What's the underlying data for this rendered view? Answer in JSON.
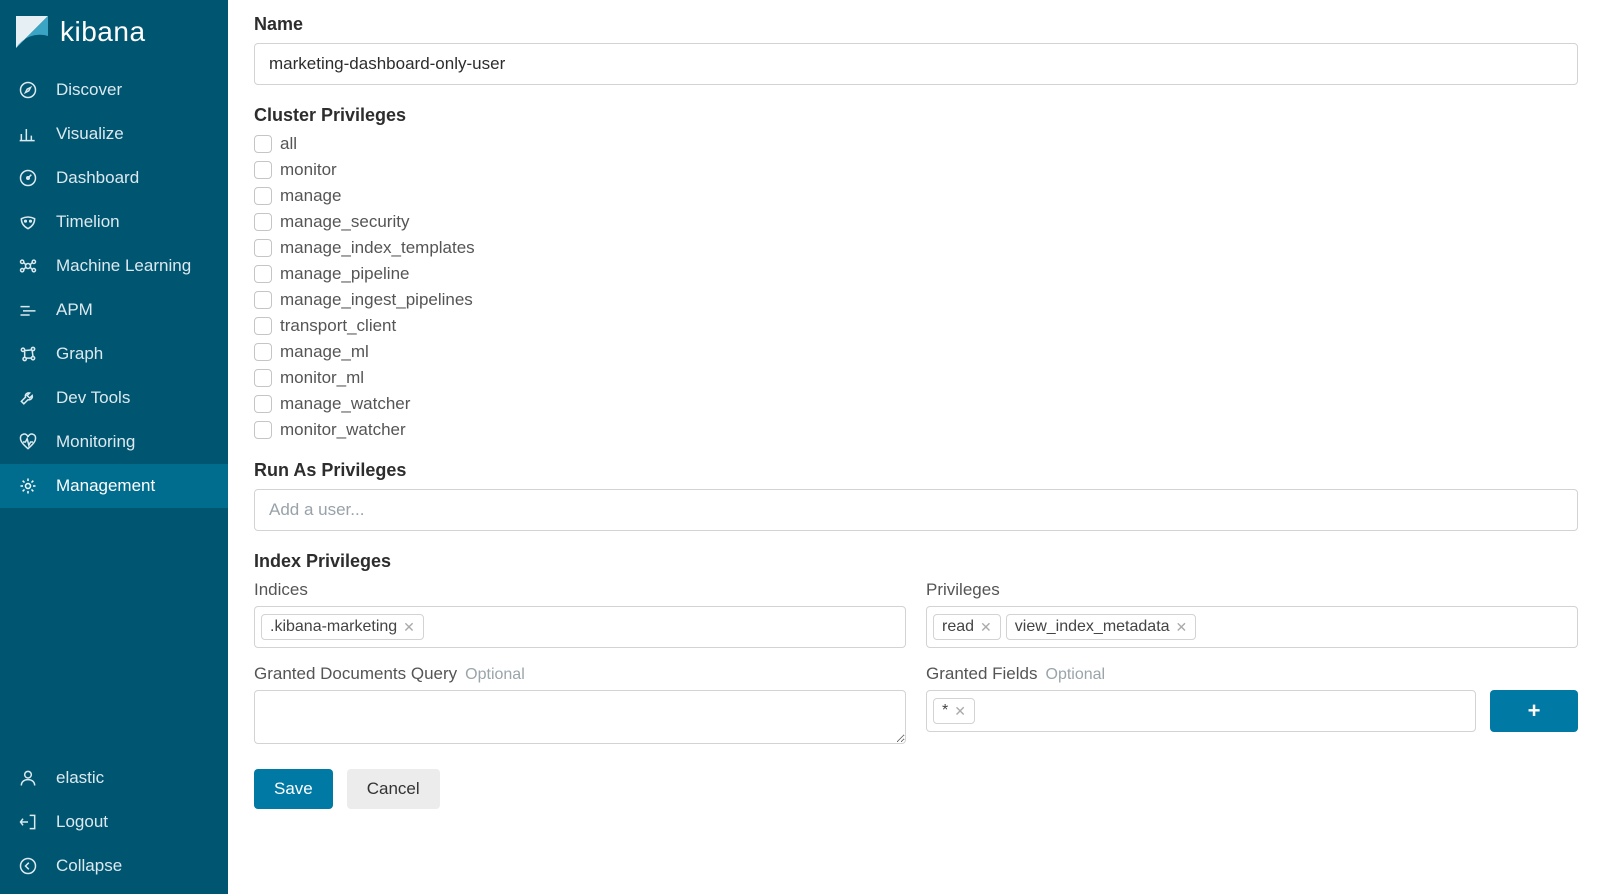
{
  "brand": {
    "name": "kibana"
  },
  "sidebar": {
    "items": [
      {
        "label": "Discover",
        "icon": "compass"
      },
      {
        "label": "Visualize",
        "icon": "barchart"
      },
      {
        "label": "Dashboard",
        "icon": "gauge"
      },
      {
        "label": "Timelion",
        "icon": "mask"
      },
      {
        "label": "Machine Learning",
        "icon": "ml"
      },
      {
        "label": "APM",
        "icon": "apm"
      },
      {
        "label": "Graph",
        "icon": "graph"
      },
      {
        "label": "Dev Tools",
        "icon": "wrench"
      },
      {
        "label": "Monitoring",
        "icon": "heartbeat"
      },
      {
        "label": "Management",
        "icon": "gear",
        "active": true
      }
    ],
    "bottom": [
      {
        "label": "elastic",
        "icon": "user"
      },
      {
        "label": "Logout",
        "icon": "logout"
      },
      {
        "label": "Collapse",
        "icon": "collapse"
      }
    ]
  },
  "form": {
    "name_label": "Name",
    "name_value": "marketing-dashboard-only-user",
    "cluster_privileges_label": "Cluster Privileges",
    "cluster_privileges": [
      "all",
      "monitor",
      "manage",
      "manage_security",
      "manage_index_templates",
      "manage_pipeline",
      "manage_ingest_pipelines",
      "transport_client",
      "manage_ml",
      "monitor_ml",
      "manage_watcher",
      "monitor_watcher"
    ],
    "run_as_label": "Run As Privileges",
    "run_as_placeholder": "Add a user...",
    "index_privileges_label": "Index Privileges",
    "indices_label": "Indices",
    "indices_tags": [
      ".kibana-marketing"
    ],
    "privileges_label": "Privileges",
    "privileges_tags": [
      "read",
      "view_index_metadata"
    ],
    "granted_docs_label": "Granted Documents Query",
    "granted_fields_label": "Granted Fields",
    "optional_text": "Optional",
    "granted_fields_tags": [
      "*"
    ],
    "save_label": "Save",
    "cancel_label": "Cancel",
    "add_icon": "+"
  }
}
